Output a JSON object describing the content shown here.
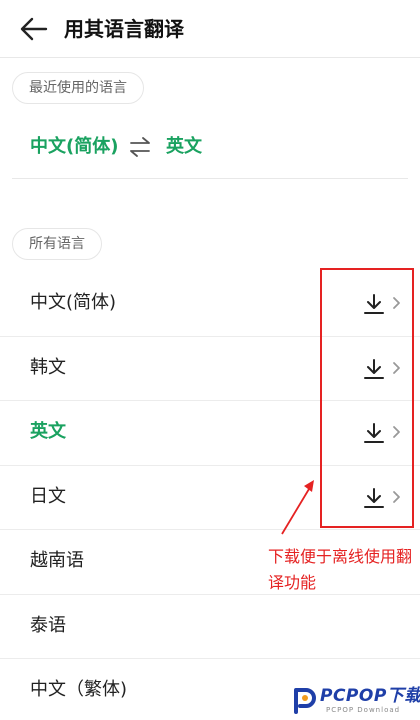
{
  "header": {
    "title": "用其语言翻译"
  },
  "recent": {
    "chip_label": "最近使用的语言",
    "source_lang": "中文(简体)",
    "target_lang": "英文"
  },
  "all": {
    "chip_label": "所有语言",
    "items": [
      {
        "label": "中文(简体)",
        "downloadable": true
      },
      {
        "label": "韩文",
        "downloadable": true
      },
      {
        "label": "英文",
        "downloadable": true,
        "selected": true
      },
      {
        "label": "日文",
        "downloadable": true
      },
      {
        "label": "越南语"
      },
      {
        "label": "泰语"
      },
      {
        "label": "中文（繁体)"
      }
    ]
  },
  "annotation": {
    "text": "下载便于离线使用翻译功能"
  },
  "watermark": {
    "brand": "PCPOP下载",
    "sub": "PCPOP Download"
  },
  "colors": {
    "accent": "#1aa260",
    "annotation": "#e52222",
    "watermark": "#1f3fa8"
  },
  "icons": [
    "back-arrow-icon",
    "swap-icon",
    "download-icon",
    "chevron-right-icon",
    "annotation-arrow-icon",
    "pcpop-logo-icon"
  ]
}
